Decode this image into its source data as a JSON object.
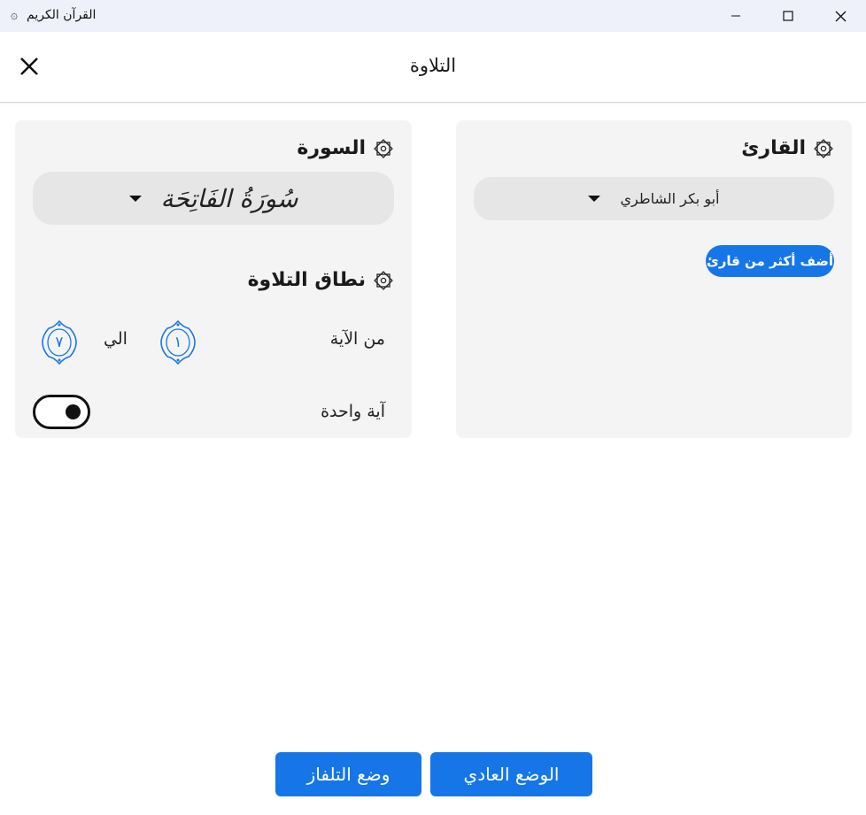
{
  "window": {
    "title": "القرآن الكريم",
    "app_icon": "quran-calligraphy-icon",
    "controls": [
      "minimize-icon",
      "maximize-icon",
      "close-icon"
    ]
  },
  "header": {
    "title": "التلاوة",
    "close_icon": "close-icon"
  },
  "surah_section": {
    "heading": "السورة",
    "heading_icon": "octagon-star-icon",
    "selected_surah": "سُورَةُ الفَاتِحَة"
  },
  "range_section": {
    "heading": "نطاق التلاوة",
    "heading_icon": "octagon-star-icon",
    "from_label": "من الآية",
    "from_value": "١",
    "to_label": "الي",
    "to_value": "٧",
    "single_ayah_label": "آية واحدة",
    "single_ayah_on": true
  },
  "reciter_section": {
    "heading": "القارئ",
    "heading_icon": "octagon-star-icon",
    "selected_reciter": "أبو بكر الشاطري",
    "add_button": "أضف أكثر من قارئ"
  },
  "footer": {
    "normal_mode": "الوضع العادي",
    "tv_mode": "وضع التلفاز"
  },
  "colors": {
    "accent": "#1676e8",
    "card_bg": "#f4f4f4",
    "dropdown_bg": "#e6e6e6",
    "titlebar_bg": "#eef1fa"
  }
}
